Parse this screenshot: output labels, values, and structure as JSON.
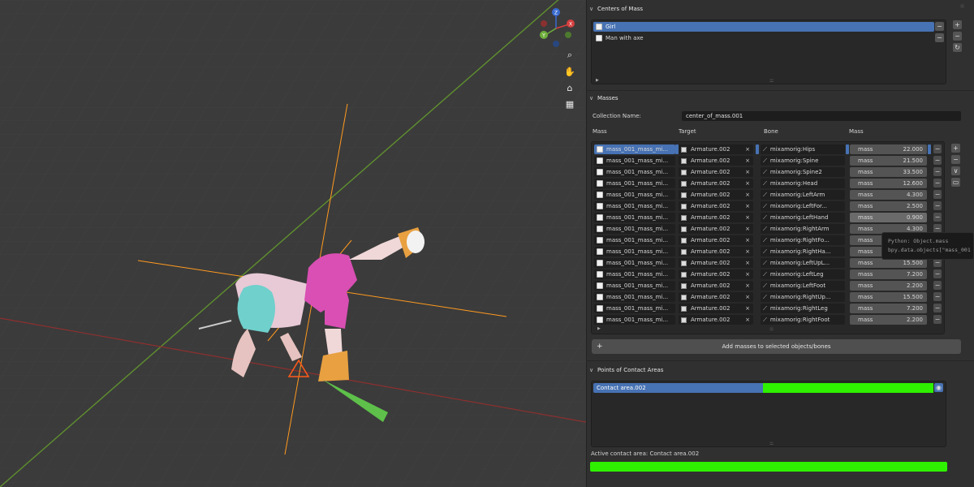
{
  "centers_of_mass": {
    "header": "Centers of Mass",
    "items": [
      {
        "label": "Girl",
        "selected": true
      },
      {
        "label": "Man with axe",
        "selected": false
      }
    ]
  },
  "masses": {
    "header": "Masses",
    "collection_name_label": "Collection Name:",
    "collection_name_value": "center_of_mass.001",
    "columns": [
      "Mass",
      "Target",
      "Bone",
      "Mass"
    ],
    "field_label": "mass",
    "rows": [
      {
        "name": "mass_001_mass_mi...",
        "target": "Armature.002",
        "bone": "mixamorig:Hips",
        "mass": "22.000"
      },
      {
        "name": "mass_001_mass_mi...",
        "target": "Armature.002",
        "bone": "mixamorig:Spine",
        "mass": "21.500"
      },
      {
        "name": "mass_001_mass_mi...",
        "target": "Armature.002",
        "bone": "mixamorig:Spine2",
        "mass": "33.500"
      },
      {
        "name": "mass_001_mass_mi...",
        "target": "Armature.002",
        "bone": "mixamorig:Head",
        "mass": "12.600"
      },
      {
        "name": "mass_001_mass_mi...",
        "target": "Armature.002",
        "bone": "mixamorig:LeftArm",
        "mass": "4.300"
      },
      {
        "name": "mass_001_mass_mi...",
        "target": "Armature.002",
        "bone": "mixamorig:LeftFor...",
        "mass": "2.500"
      },
      {
        "name": "mass_001_mass_mi...",
        "target": "Armature.002",
        "bone": "mixamorig:LeftHand",
        "mass": "0.900"
      },
      {
        "name": "mass_001_mass_mi...",
        "target": "Armature.002",
        "bone": "mixamorig:RightArm",
        "mass": "4.300"
      },
      {
        "name": "mass_001_mass_mi...",
        "target": "Armature.002",
        "bone": "mixamorig:RightFo...",
        "mass": ""
      },
      {
        "name": "mass_001_mass_mi...",
        "target": "Armature.002",
        "bone": "mixamorig:RightHa...",
        "mass": ""
      },
      {
        "name": "mass_001_mass_mi...",
        "target": "Armature.002",
        "bone": "mixamorig:LeftUpL...",
        "mass": "15.500"
      },
      {
        "name": "mass_001_mass_mi...",
        "target": "Armature.002",
        "bone": "mixamorig:LeftLeg",
        "mass": "7.200"
      },
      {
        "name": "mass_001_mass_mi...",
        "target": "Armature.002",
        "bone": "mixamorig:LeftFoot",
        "mass": "2.200"
      },
      {
        "name": "mass_001_mass_mi...",
        "target": "Armature.002",
        "bone": "mixamorig:RightUp...",
        "mass": "15.500"
      },
      {
        "name": "mass_001_mass_mi...",
        "target": "Armature.002",
        "bone": "mixamorig:RightLeg",
        "mass": "7.200"
      },
      {
        "name": "mass_001_mass_mi...",
        "target": "Armature.002",
        "bone": "mixamorig:RightFoot",
        "mass": "2.200"
      }
    ],
    "add_button": "Add masses to selected objects/bones"
  },
  "tooltip": {
    "line1": "Python: Object.mass",
    "line2": "bpy.data.objects[\"mass_001"
  },
  "contact_areas": {
    "header": "Points of Contact Areas",
    "items": [
      {
        "label": "Contact area.002"
      }
    ],
    "active_label": "Active contact area: Contact area.002"
  },
  "colors": {
    "selection": "#4772b3",
    "contact_green": "#2ef000",
    "axis_x": "#c0392b",
    "axis_y": "#6aa84f"
  },
  "icons": {
    "add": "+",
    "remove": "−",
    "clear": "×",
    "refresh": "↻",
    "eye": "eye-icon"
  }
}
